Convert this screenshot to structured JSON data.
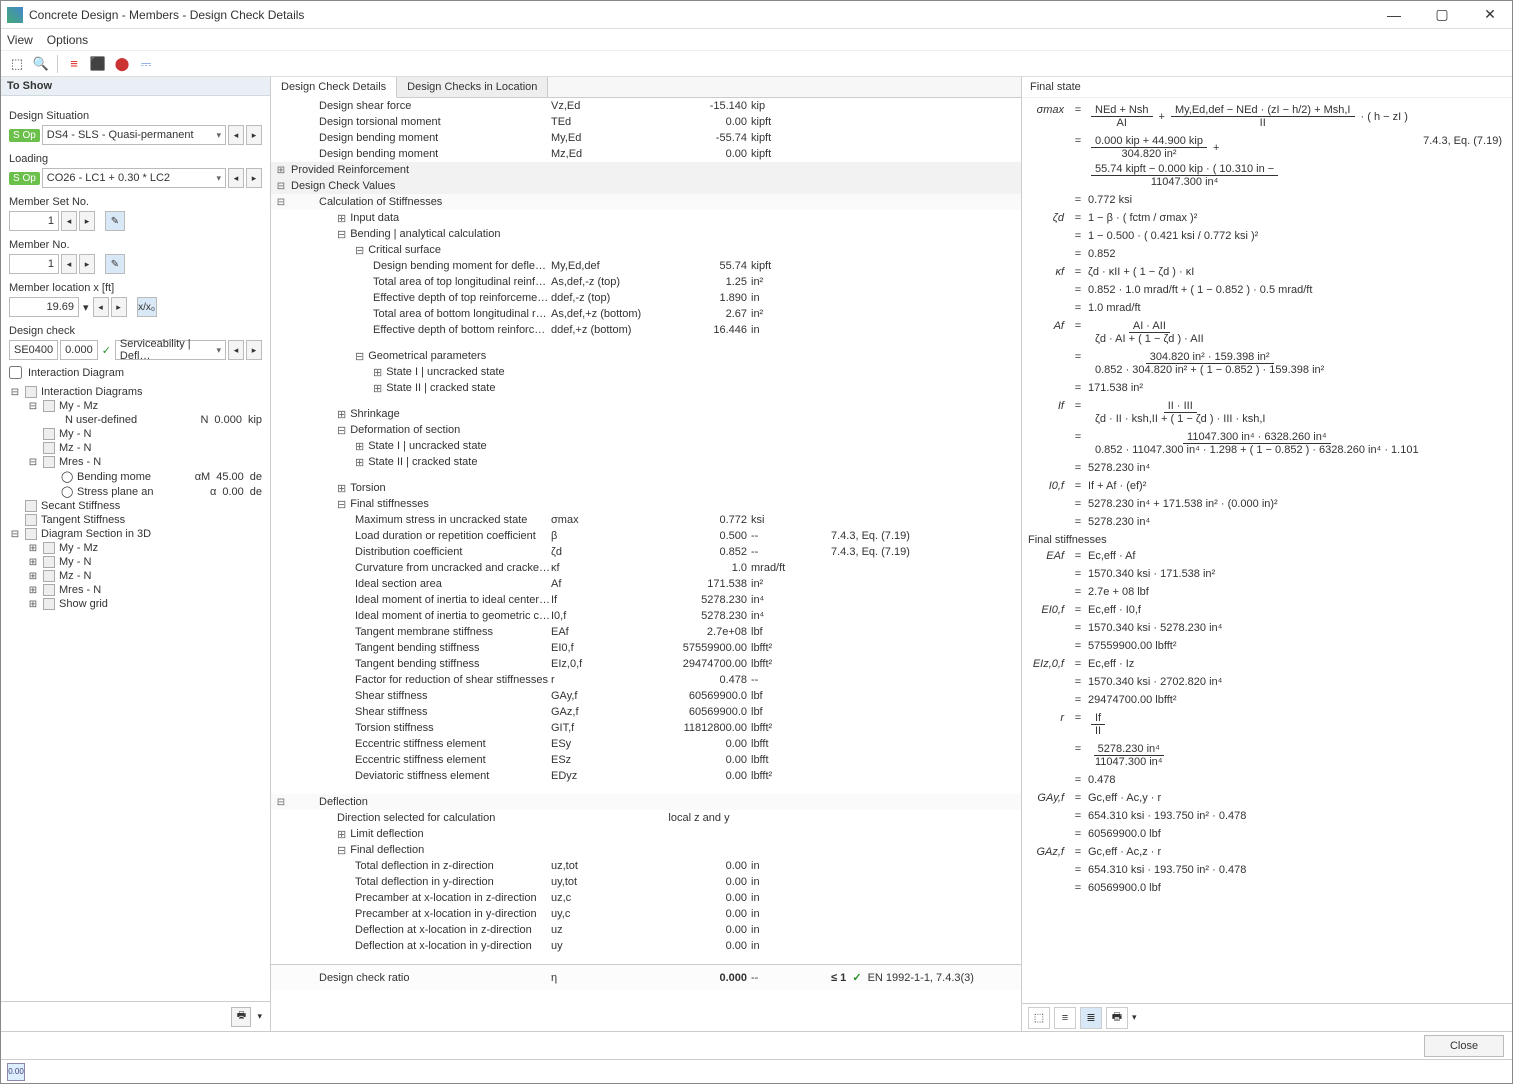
{
  "window": {
    "title": "Concrete Design - Members - Design Check Details"
  },
  "menubar": {
    "view": "View",
    "options": "Options"
  },
  "left": {
    "to_show": "To Show",
    "design_situation_label": "Design Situation",
    "design_situation_value": "DS4 - SLS - Quasi-permanent",
    "loading_label": "Loading",
    "loading_value": "CO26 - LC1 + 0.30 * LC2",
    "member_set_no_label": "Member Set No.",
    "member_set_no_value": "1",
    "member_no_label": "Member No.",
    "member_no_value": "1",
    "member_location_label": "Member location x [ft]",
    "member_location_value": "19.69",
    "design_check_label": "Design check",
    "design_check_code": "SE0400",
    "design_check_ratio": "0.000",
    "design_check_desc": "Serviceability | Defl…",
    "interaction_diagram_label": "Interaction Diagram",
    "tree": {
      "interaction_diagrams": "Interaction Diagrams",
      "my_mz": "My - Mz",
      "n_user_defined": "N user-defined",
      "n_user_defined_sym": "N",
      "n_user_defined_val": "0.000",
      "n_user_defined_unit": "kip",
      "my_n": "My - N",
      "mz_n": "Mz - N",
      "mres_n": "Mres - N",
      "bending_moment": "Bending mome",
      "bending_moment_sym": "αM",
      "bending_moment_val": "45.00",
      "bending_moment_unit": "de",
      "stress_plane": "Stress plane an",
      "stress_plane_sym": "α",
      "stress_plane_val": "0.00",
      "stress_plane_unit": "de",
      "secant": "Secant Stiffness",
      "tangent": "Tangent Stiffness",
      "diagram_3d": "Diagram Section in 3D",
      "show_grid": "Show grid"
    }
  },
  "center": {
    "tab1": "Design Check Details",
    "tab2": "Design Checks in Location",
    "top_rows": [
      {
        "label": "Design shear force",
        "sym": "Vz,Ed",
        "val": "-15.140",
        "unit": "kip"
      },
      {
        "label": "Design torsional moment",
        "sym": "TEd",
        "val": "0.00",
        "unit": "kipft"
      },
      {
        "label": "Design bending moment",
        "sym": "My,Ed",
        "val": "-55.74",
        "unit": "kipft"
      },
      {
        "label": "Design bending moment",
        "sym": "Mz,Ed",
        "val": "0.00",
        "unit": "kipft"
      }
    ],
    "groups": {
      "provided_reinforcement": "Provided Reinforcement",
      "design_check_values": "Design Check Values",
      "calc_stiff": "Calculation of Stiffnesses",
      "input_data": "Input data",
      "bending_analytical": "Bending | analytical calculation",
      "critical_surface": "Critical surface",
      "geom_params": "Geometrical parameters",
      "state1_uncracked": "State I | uncracked state",
      "state2_cracked": "State II | cracked state",
      "shrinkage": "Shrinkage",
      "deformation": "Deformation of section",
      "torsion": "Torsion",
      "final_stiff": "Final stiffnesses",
      "deflection": "Deflection",
      "limit_deflection": "Limit deflection",
      "final_deflection": "Final deflection",
      "direction_selected": "Direction selected for calculation",
      "direction_selected_val": "local z and y"
    },
    "critical_rows": [
      {
        "label": "Design bending moment for deflection calcul…",
        "sym": "My,Ed,def",
        "val": "55.74",
        "unit": "kipft"
      },
      {
        "label": "Total area of top longitudinal reinforcement (f…",
        "sym": "As,def,-z (top)",
        "val": "1.25",
        "unit": "in²"
      },
      {
        "label": "Effective depth of top reinforcement (for defl…",
        "sym": "ddef,-z (top)",
        "val": "1.890",
        "unit": "in"
      },
      {
        "label": "Total area of bottom longitudinal reinforceme…",
        "sym": "As,def,+z (bottom)",
        "val": "2.67",
        "unit": "in²"
      },
      {
        "label": "Effective depth of bottom reinforcement (for …",
        "sym": "ddef,+z (bottom)",
        "val": "16.446",
        "unit": "in"
      }
    ],
    "final_stiff_rows": [
      {
        "label": "Maximum stress in uncracked state",
        "sym": "σmax",
        "val": "0.772",
        "unit": "ksi",
        "ref": ""
      },
      {
        "label": "Load duration or repetition coefficient",
        "sym": "β",
        "val": "0.500",
        "unit": "--",
        "ref": "7.4.3, Eq. (7.19)"
      },
      {
        "label": "Distribution coefficient",
        "sym": "ζd",
        "val": "0.852",
        "unit": "--",
        "ref": "7.4.3, Eq. (7.19)"
      },
      {
        "label": "Curvature from uncracked and cracked state",
        "sym": "κf",
        "val": "1.0",
        "unit": "mrad/ft",
        "ref": ""
      },
      {
        "label": "Ideal section area",
        "sym": "Af",
        "val": "171.538",
        "unit": "in²",
        "ref": ""
      },
      {
        "label": "Ideal moment of inertia to ideal center of section",
        "sym": "If",
        "val": "5278.230",
        "unit": "in⁴",
        "ref": ""
      },
      {
        "label": "Ideal moment of inertia to geometric center of se…",
        "sym": "I0,f",
        "val": "5278.230",
        "unit": "in⁴",
        "ref": ""
      },
      {
        "label": "Tangent membrane stiffness",
        "sym": "EAf",
        "val": "2.7e+08",
        "unit": "lbf",
        "ref": ""
      },
      {
        "label": "Tangent bending stiffness",
        "sym": "EI0,f",
        "val": "57559900.00",
        "unit": "lbfft²",
        "ref": ""
      },
      {
        "label": "Tangent bending stiffness",
        "sym": "EIz,0,f",
        "val": "29474700.00",
        "unit": "lbfft²",
        "ref": ""
      },
      {
        "label": "Factor for reduction of shear stiffnesses",
        "sym": "r",
        "val": "0.478",
        "unit": "--",
        "ref": ""
      },
      {
        "label": "Shear stiffness",
        "sym": "GAy,f",
        "val": "60569900.0",
        "unit": "lbf",
        "ref": ""
      },
      {
        "label": "Shear stiffness",
        "sym": "GAz,f",
        "val": "60569900.0",
        "unit": "lbf",
        "ref": ""
      },
      {
        "label": "Torsion stiffness",
        "sym": "GIT,f",
        "val": "11812800.00",
        "unit": "lbfft²",
        "ref": ""
      },
      {
        "label": "Eccentric stiffness element",
        "sym": "ESy",
        "val": "0.00",
        "unit": "lbfft",
        "ref": ""
      },
      {
        "label": "Eccentric stiffness element",
        "sym": "ESz",
        "val": "0.00",
        "unit": "lbfft",
        "ref": ""
      },
      {
        "label": "Deviatoric stiffness element",
        "sym": "EDyz",
        "val": "0.00",
        "unit": "lbfft²",
        "ref": ""
      }
    ],
    "final_defl_rows": [
      {
        "label": "Total deflection in z-direction",
        "sym": "uz,tot",
        "val": "0.00",
        "unit": "in"
      },
      {
        "label": "Total deflection in y-direction",
        "sym": "uy,tot",
        "val": "0.00",
        "unit": "in"
      },
      {
        "label": "Precamber at x-location in z-direction",
        "sym": "uz,c",
        "val": "0.00",
        "unit": "in"
      },
      {
        "label": "Precamber at x-location in y-direction",
        "sym": "uy,c",
        "val": "0.00",
        "unit": "in"
      },
      {
        "label": "Deflection at x-location in z-direction",
        "sym": "uz",
        "val": "0.00",
        "unit": "in"
      },
      {
        "label": "Deflection at x-location in y-direction",
        "sym": "uy",
        "val": "0.00",
        "unit": "in"
      }
    ],
    "ratio": {
      "label": "Design check ratio",
      "sym": "η",
      "val": "0.000",
      "unit": "--",
      "limit": "≤ 1",
      "ref": "EN 1992-1-1, 7.4.3(3)"
    }
  },
  "right": {
    "title": "Final state",
    "sigma_max": {
      "lhs": "σmax",
      "rhs_num1": "NEd  +  Nsh",
      "rhs_den1": "AI",
      "rhs_num2": "My,Ed,def  −  NEd · (zI − h/2)  +  Msh,I",
      "rhs_den2": "II",
      "tail": "· ( h  −  zI )"
    },
    "sigma_num": {
      "line2a": "0.000 kip  +  44.900 kip",
      "line2b": "304.820 in²",
      "line2c": "55.74 kipft  −  0.000 kip  ·  ( 10.310 in  −",
      "line2d": "11047.300 in⁴",
      "line3": "0.772 ksi",
      "ref": "7.4.3, Eq. (7.19)"
    },
    "zeta": {
      "lhs": "ζd",
      "r1": "1  −  β  ·  ( fctm / σmax )²",
      "r2": "1  −  0.500  ·  ( 0.421 ksi / 0.772 ksi )²",
      "r3": "0.852"
    },
    "kappa": {
      "lhs": "κf",
      "r1": "ζd · κII  +  ( 1  −  ζd ) · κI",
      "r2": "0.852 · 1.0 mrad/ft  +  ( 1  −  0.852 ) · 0.5 mrad/ft",
      "r3": "1.0 mrad/ft"
    },
    "af": {
      "lhs": "Af",
      "num": "AI · AII",
      "den": "ζd · AI  +  ( 1  −  ζd ) · AII",
      "r2n": "304.820 in² · 159.398 in²",
      "r2d": "0.852 · 304.820 in²  +  ( 1  −  0.852 ) · 159.398 in²",
      "r3": "171.538 in²"
    },
    "if": {
      "lhs": "If",
      "num": "II · III",
      "den": "ζd · II · ksh,II  +  ( 1  −  ζd ) · III · ksh,I",
      "r2n": "11047.300 in⁴ · 6328.260 in⁴",
      "r2d": "0.852 · 11047.300 in⁴ · 1.298  +  ( 1  −  0.852 ) · 6328.260 in⁴ · 1.101",
      "r3": "5278.230 in⁴"
    },
    "i0f": {
      "lhs": "I0,f",
      "r1": "If  +  Af  ·  (ef)²",
      "r2": "5278.230 in⁴  +  171.538 in²  ·  (0.000 in)²",
      "r3": "5278.230 in⁴"
    },
    "final_stiff_title": "Final stiffnesses",
    "eaf": {
      "lhs": "EAf",
      "r1": "Ec,eff  ·  Af",
      "r2": "1570.340 ksi  ·  171.538 in²",
      "r3": "2.7e + 08 lbf"
    },
    "ei0f": {
      "lhs": "EI0,f",
      "r1": "Ec,eff  ·  I0,f",
      "r2": "1570.340 ksi  ·  5278.230 in⁴",
      "r3": "57559900.00 lbfft²"
    },
    "eiz0f": {
      "lhs": "EIz,0,f",
      "r1": "Ec,eff  ·  Iz",
      "r2": "1570.340 ksi  ·  2702.820 in⁴",
      "r3": "29474700.00 lbfft²"
    },
    "rfac": {
      "lhs": "r",
      "num": "If",
      "den": "II",
      "r2n": "5278.230 in⁴",
      "r2d": "11047.300 in⁴",
      "r3": "0.478"
    },
    "gayf": {
      "lhs": "GAy,f",
      "r1": "Gc,eff  ·  Ac,y  ·  r",
      "r2": "654.310 ksi  ·  193.750 in²  ·  0.478",
      "r3": "60569900.0 lbf"
    },
    "gazf": {
      "lhs": "GAz,f",
      "r1": "Gc,eff  ·  Ac,z  ·  r",
      "r2": "654.310 ksi  ·  193.750 in²  ·  0.478",
      "r3": "60569900.0 lbf"
    }
  },
  "footer": {
    "close": "Close"
  },
  "status": {
    "icon_text": "0.00"
  }
}
